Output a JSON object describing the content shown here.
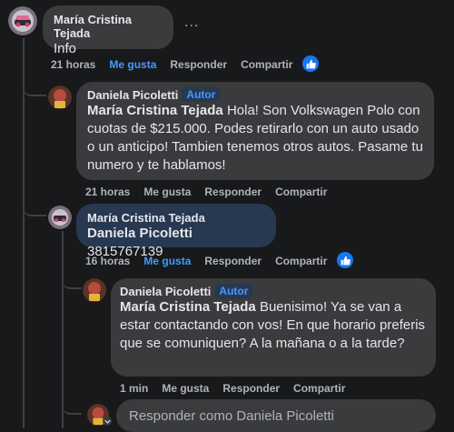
{
  "colors": {
    "background": "#18191a",
    "bubble": "#3a3b3c",
    "bubble_highlight": "#263951",
    "accent": "#4599ff",
    "secondary_text": "#b0b3b8"
  },
  "comments": [
    {
      "author": "María Cristina Tejada",
      "text": "Info",
      "more": "...",
      "time": "21 horas",
      "like": "Me gusta",
      "liked": true,
      "reply": "Responder",
      "share": "Compartir",
      "reaction": "like-icon"
    },
    {
      "author": "Daniela Picoletti",
      "badge": "Autor",
      "mention": "María Cristina Tejada",
      "text": "Hola! Son Volkswagen Polo con cuotas de $215.000. Podes retirarlo con un auto usado o un anticipo! Tambien tenemos otros autos. Pasame tu numero y te hablamos!",
      "time": "21 horas",
      "like": "Me gusta",
      "reply": "Responder",
      "share": "Compartir"
    },
    {
      "author": "María Cristina Tejada",
      "mention": "Daniela Picoletti",
      "text": "3815767139",
      "time": "16 horas",
      "like": "Me gusta",
      "liked": true,
      "reply": "Responder",
      "share": "Compartir",
      "reaction": "like-icon"
    },
    {
      "author": "Daniela Picoletti",
      "badge": "Autor",
      "mention": "María Cristina Tejada",
      "text": "Buenisimo! Ya se van a estar contactando con vos! En que horario preferis que se comuniquen? A la mañana o a la tarde?",
      "time": "1 min",
      "like": "Me gusta",
      "reply": "Responder",
      "share": "Compartir"
    }
  ],
  "reply_box": {
    "placeholder": "Responder como Daniela Picoletti"
  }
}
